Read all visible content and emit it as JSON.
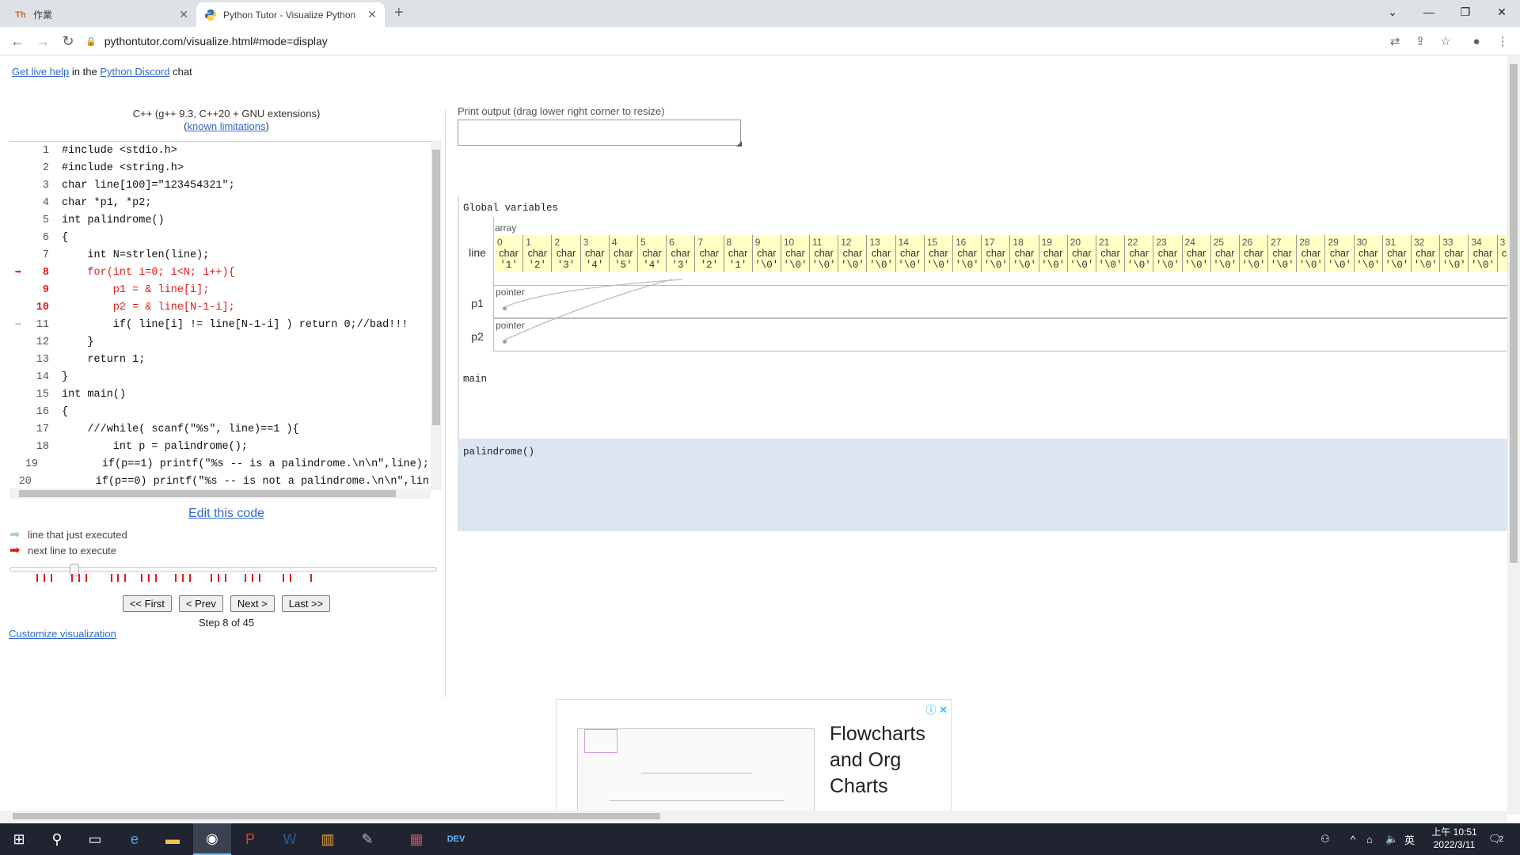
{
  "browser": {
    "tabs": [
      {
        "title": "作業",
        "favicon": "ms-teams-like-icon"
      },
      {
        "title": "Python Tutor - Visualize Python",
        "favicon": "python-icon"
      }
    ],
    "url": "pythontutor.com/visualize.html#mode=display"
  },
  "header": {
    "live_help_link": "Get live help",
    "in_the": "in the",
    "discord_link": "Python Discord",
    "chat": "chat"
  },
  "editor": {
    "language": "C++ (g++ 9.3, C++20 + GNU extensions)",
    "limitations_link": "known limitations",
    "lines": [
      {
        "n": "1",
        "text": "#include <stdio.h>",
        "mark": ""
      },
      {
        "n": "2",
        "text": "#include <string.h>",
        "mark": ""
      },
      {
        "n": "3",
        "text": "char line[100]=\"123454321\";",
        "mark": ""
      },
      {
        "n": "4",
        "text": "char *p1, *p2;",
        "mark": ""
      },
      {
        "n": "5",
        "text": "int palindrome()",
        "mark": ""
      },
      {
        "n": "6",
        "text": "{",
        "mark": ""
      },
      {
        "n": "7",
        "text": "    int N=strlen(line);",
        "mark": ""
      },
      {
        "n": "8",
        "text": "    for(int i=0; i<N; i++){",
        "mark": "next"
      },
      {
        "n": "9",
        "text": "        p1 = & line[i];",
        "mark": "next"
      },
      {
        "n": "10",
        "text": "        p2 = & line[N-1-i];",
        "mark": "next"
      },
      {
        "n": "11",
        "text": "        if( line[i] != line[N-1-i] ) return 0;//bad!!!",
        "mark": "prev"
      },
      {
        "n": "12",
        "text": "    }",
        "mark": ""
      },
      {
        "n": "13",
        "text": "    return 1;",
        "mark": ""
      },
      {
        "n": "14",
        "text": "}",
        "mark": ""
      },
      {
        "n": "15",
        "text": "int main()",
        "mark": ""
      },
      {
        "n": "16",
        "text": "{",
        "mark": ""
      },
      {
        "n": "17",
        "text": "    ///while( scanf(\"%s\", line)==1 ){",
        "mark": ""
      },
      {
        "n": "18",
        "text": "        int p = palindrome();",
        "mark": ""
      },
      {
        "n": "19",
        "text": "        if(p==1) printf(\"%s -- is a palindrome.\\n\\n\",line);",
        "mark": ""
      },
      {
        "n": "20",
        "text": "        if(p==0) printf(\"%s -- is not a palindrome.\\n\\n\",lin",
        "mark": ""
      }
    ],
    "edit_link": "Edit this code",
    "legend_prev": "line that just executed",
    "legend_next": "next line to execute",
    "buttons": {
      "first": "<< First",
      "prev": "< Prev",
      "next": "Next >",
      "last": "Last >>"
    },
    "step_text": "Step 8 of 45",
    "customize_link": "Customize visualization",
    "step_current": 8,
    "step_total": 45
  },
  "visual": {
    "print_label": "Print output (drag lower right corner to resize)",
    "globals_title": "Global variables",
    "array_label": "array",
    "var_line": "line",
    "var_p1": "p1",
    "var_p2": "p2",
    "pointer_label": "pointer",
    "cell_type": "char",
    "cells": [
      {
        "i": "0",
        "v": "'1'"
      },
      {
        "i": "1",
        "v": "'2'"
      },
      {
        "i": "2",
        "v": "'3'"
      },
      {
        "i": "3",
        "v": "'4'"
      },
      {
        "i": "4",
        "v": "'5'"
      },
      {
        "i": "5",
        "v": "'4'"
      },
      {
        "i": "6",
        "v": "'3'"
      },
      {
        "i": "7",
        "v": "'2'"
      },
      {
        "i": "8",
        "v": "'1'"
      },
      {
        "i": "9",
        "v": "'\\0'"
      },
      {
        "i": "10",
        "v": "'\\0'"
      },
      {
        "i": "11",
        "v": "'\\0'"
      },
      {
        "i": "12",
        "v": "'\\0'"
      },
      {
        "i": "13",
        "v": "'\\0'"
      },
      {
        "i": "14",
        "v": "'\\0'"
      },
      {
        "i": "15",
        "v": "'\\0'"
      },
      {
        "i": "16",
        "v": "'\\0'"
      },
      {
        "i": "17",
        "v": "'\\0'"
      },
      {
        "i": "18",
        "v": "'\\0'"
      },
      {
        "i": "19",
        "v": "'\\0'"
      },
      {
        "i": "20",
        "v": "'\\0'"
      },
      {
        "i": "21",
        "v": "'\\0'"
      },
      {
        "i": "22",
        "v": "'\\0'"
      },
      {
        "i": "23",
        "v": "'\\0'"
      },
      {
        "i": "24",
        "v": "'\\0'"
      },
      {
        "i": "25",
        "v": "'\\0'"
      },
      {
        "i": "26",
        "v": "'\\0'"
      },
      {
        "i": "27",
        "v": "'\\0'"
      },
      {
        "i": "28",
        "v": "'\\0'"
      },
      {
        "i": "29",
        "v": "'\\0'"
      },
      {
        "i": "30",
        "v": "'\\0'"
      },
      {
        "i": "31",
        "v": "'\\0'"
      },
      {
        "i": "32",
        "v": "'\\0'"
      },
      {
        "i": "33",
        "v": "'\\0'"
      },
      {
        "i": "34",
        "v": "'\\0'"
      },
      {
        "i": "3",
        "v": "'\\"
      }
    ],
    "frame_main": "main",
    "frame_active": "palindrome()"
  },
  "ad": {
    "headline": "Flowcharts and Org Charts"
  },
  "taskbar": {
    "time": "上午 10:51",
    "date": "2022/3/11",
    "ime": "英",
    "notif_count": "2"
  },
  "colors": {
    "next_arrow": "#e21b1b",
    "prev_arrow": "#a2dca2",
    "array_cell": "#ffffc6",
    "active_frame": "#dde5f1",
    "link": "#3366cc"
  }
}
